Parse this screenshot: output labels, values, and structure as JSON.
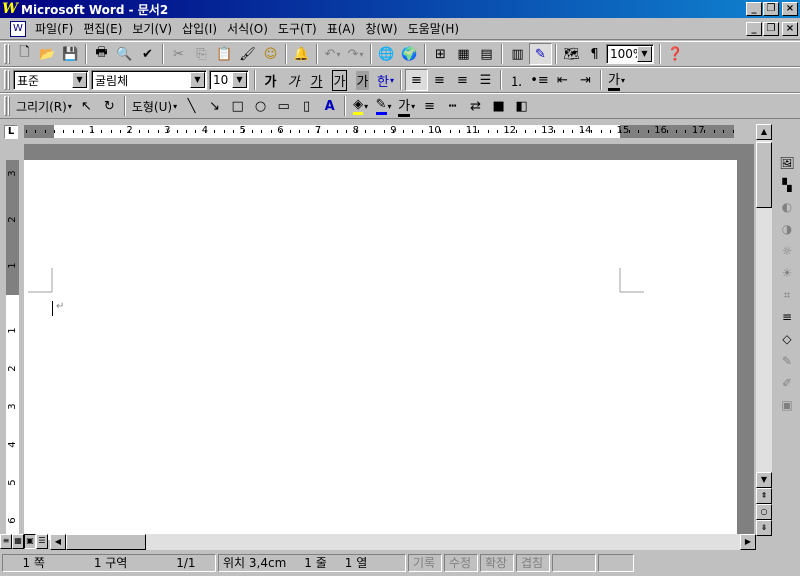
{
  "window": {
    "title": "Microsoft Word - 문서2",
    "icon": "word-app-icon",
    "min_glyph": "_",
    "restore_glyph": "❐",
    "close_glyph": "×"
  },
  "menu": [
    "파일(F)",
    "편집(E)",
    "보기(V)",
    "삽입(I)",
    "서식(O)",
    "도구(T)",
    "표(A)",
    "창(W)",
    "도움말(H)"
  ],
  "standard_toolbar": {
    "zoom": "100%"
  },
  "format_toolbar": {
    "style": "표준",
    "font": "굴림체",
    "size": "10",
    "bold_glyph": "가",
    "italic_glyph": "가",
    "underline_glyph": "가",
    "border_char_glyph": "가",
    "shade_char_glyph": "가",
    "phonetic_glyph": "한",
    "font_color_glyph": "가"
  },
  "drawing_toolbar": {
    "draw_label": "그리기(R)",
    "autoshapes_label": "도형(U)",
    "font_color_glyph": "가"
  },
  "ruler": {
    "tab_glyph": "L",
    "h_numbers": [
      "1",
      "2",
      "3",
      "4",
      "5",
      "6",
      "7",
      "8",
      "9",
      "10",
      "11",
      "12",
      "13",
      "14",
      "15",
      "16",
      "17"
    ],
    "v_top_numbers": [
      "3",
      "2",
      "1"
    ],
    "v_numbers": [
      "1",
      "2",
      "3",
      "4",
      "5",
      "6"
    ]
  },
  "document": {
    "para_mark": "↵"
  },
  "status": {
    "page": "1 쪽",
    "section": "1 구역",
    "page_of": "1/1",
    "position": "위치 3,4cm",
    "line": "1 줄",
    "column": "1 열",
    "rec": "기록",
    "trk": "수정",
    "ext": "확장",
    "ovr": "겹침"
  }
}
